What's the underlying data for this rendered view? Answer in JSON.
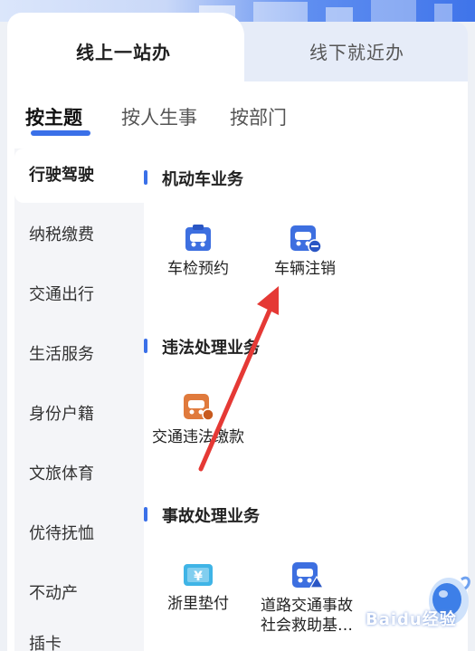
{
  "mode_tabs": [
    {
      "label": "线上一站办",
      "active": true
    },
    {
      "label": "线下就近办",
      "active": false
    }
  ],
  "topic_tabs": [
    {
      "label": "按主题",
      "active": true
    },
    {
      "label": "按人生事",
      "active": false
    },
    {
      "label": "按部门",
      "active": false
    }
  ],
  "sidebar": {
    "items": [
      {
        "label": "行驶驾驶",
        "active": true
      },
      {
        "label": "纳税缴费"
      },
      {
        "label": "交通出行"
      },
      {
        "label": "生活服务"
      },
      {
        "label": "身份户籍"
      },
      {
        "label": "文旅体育"
      },
      {
        "label": "优待抚恤"
      },
      {
        "label": "不动产"
      },
      {
        "label": "插卡"
      }
    ]
  },
  "sections": [
    {
      "title": "机动车业务",
      "items": [
        {
          "label": "车检预约",
          "icon": "car-inspection-icon"
        },
        {
          "label": "车辆注销",
          "icon": "car-deregister-icon"
        }
      ]
    },
    {
      "title": "违法处理业务",
      "items": [
        {
          "label": "交通违法缴款",
          "icon": "violation-payment-icon"
        }
      ]
    },
    {
      "title": "事故处理业务",
      "items": [
        {
          "label": "浙里垫付",
          "icon": "advance-payment-icon"
        },
        {
          "label": "道路交通事故社会救助基…",
          "icon": "accident-fund-icon"
        }
      ]
    }
  ],
  "watermark": "Baidu经验",
  "colors": {
    "accent": "#3a70e8",
    "icon_blue": "#3d6fe0",
    "icon_orange": "#e07a3c",
    "arrow": "#e53935"
  }
}
